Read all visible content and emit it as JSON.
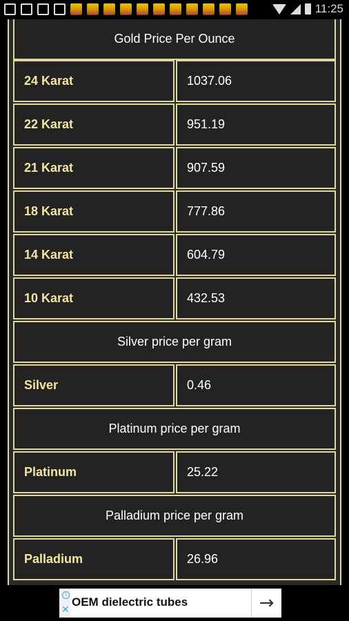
{
  "status_bar": {
    "time": "11:25",
    "icons": [
      "back-icon",
      "facebook-icon",
      "news-icon",
      "image-icon",
      "app-icon",
      "app-icon",
      "app-icon",
      "app-icon",
      "app-icon",
      "app-icon",
      "app-icon",
      "app-icon",
      "app-icon",
      "app-icon",
      "app-icon"
    ]
  },
  "table": {
    "gold_header": "Gold Price Per Ounce",
    "gold_rows": [
      {
        "label": "24 Karat",
        "value": "1037.06"
      },
      {
        "label": "22 Karat",
        "value": "951.19"
      },
      {
        "label": "21 Karat",
        "value": "907.59"
      },
      {
        "label": "18 Karat",
        "value": "777.86"
      },
      {
        "label": "14 Karat",
        "value": "604.79"
      },
      {
        "label": "10 Karat",
        "value": "432.53"
      }
    ],
    "silver_header": "Silver price per gram",
    "silver_row": {
      "label": "Silver",
      "value": "0.46"
    },
    "platinum_header": "Platinum price per gram",
    "platinum_row": {
      "label": "Platinum",
      "value": "25.22"
    },
    "palladium_header": "Palladium price per gram",
    "palladium_row": {
      "label": "Palladium",
      "value": "26.96"
    }
  },
  "ad": {
    "text": "OEM dielectric tubes",
    "arrow": "→",
    "info": "i",
    "close": "✕"
  },
  "colors": {
    "border": "#e3d7a0",
    "label_text": "#f3e4a2",
    "cell_bg": "#232323"
  }
}
